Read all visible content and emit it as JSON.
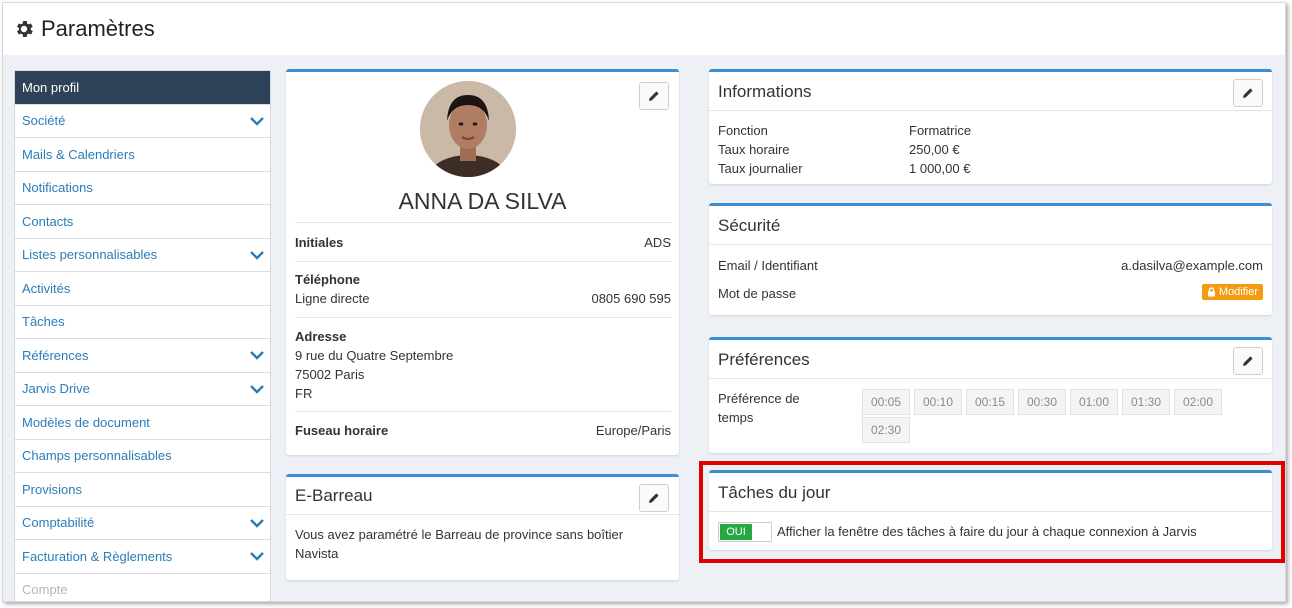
{
  "page": {
    "title": "Paramètres"
  },
  "sidebar": {
    "items": [
      {
        "label": "Mon profil"
      },
      {
        "label": "Société"
      },
      {
        "label": "Mails & Calendriers"
      },
      {
        "label": "Notifications"
      },
      {
        "label": "Contacts"
      },
      {
        "label": "Listes personnalisables"
      },
      {
        "label": "Activités"
      },
      {
        "label": "Tâches"
      },
      {
        "label": "Références"
      },
      {
        "label": "Jarvis Drive"
      },
      {
        "label": "Modèles de document"
      },
      {
        "label": "Champs personnalisables"
      },
      {
        "label": "Provisions"
      },
      {
        "label": "Comptabilité"
      },
      {
        "label": "Facturation & Règlements"
      },
      {
        "label": "Compte"
      }
    ]
  },
  "profile": {
    "name": "ANNA DA SILVA",
    "initials_label": "Initiales",
    "initials_value": "ADS",
    "phone_label": "Téléphone",
    "phone_sublabel": "Ligne directe",
    "phone_value": "0805 690 595",
    "address_label": "Adresse",
    "address_line1": "9 rue du Quatre Septembre",
    "address_line2": "75002 Paris",
    "address_line3": "FR",
    "timezone_label": "Fuseau horaire",
    "timezone_value": "Europe/Paris"
  },
  "ebarreau": {
    "title": "E-Barreau",
    "text_line1": "Vous avez paramétré le Barreau de province sans boîtier",
    "text_line2": "Navista"
  },
  "informations": {
    "title": "Informations",
    "rows": [
      {
        "label": "Fonction",
        "value": "Formatrice"
      },
      {
        "label": "Taux horaire",
        "value": "250,00 €"
      },
      {
        "label": "Taux journalier",
        "value": "1 000,00 €"
      }
    ]
  },
  "securite": {
    "title": "Sécurité",
    "email_label": "Email / Identifiant",
    "email_value": "a.dasilva@example.com",
    "password_label": "Mot de passe",
    "modify_label": "Modifier"
  },
  "preferences": {
    "title": "Préférences",
    "label_line1": "Préférence de",
    "label_line2": "temps",
    "options": [
      "00:05",
      "00:10",
      "00:15",
      "00:30",
      "01:00",
      "01:30",
      "02:00",
      "02:30"
    ]
  },
  "taches_jour": {
    "title": "Tâches du jour",
    "toggle_label": "OUI",
    "description": "Afficher la fenêtre des tâches à faire du jour à chaque connexion à Jarvis"
  },
  "colors": {
    "accent": "#3a8fd4",
    "sidebar_active": "#2e4359",
    "link": "#2a7db8",
    "highlight": "#e00000"
  }
}
